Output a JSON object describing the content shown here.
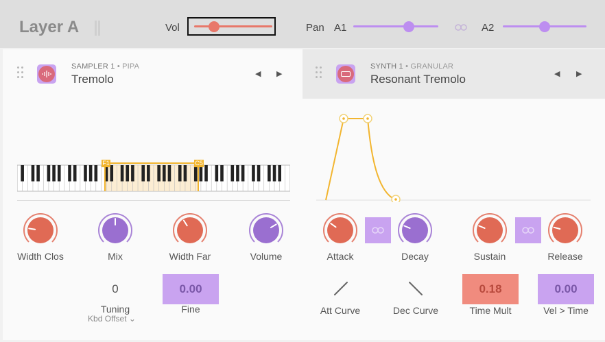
{
  "header": {
    "layer_title": "Layer A",
    "vol_label": "Vol",
    "vol_value": 0.25,
    "pan_label": "Pan",
    "a1_label": "A1",
    "a1_value": 0.65,
    "a2_label": "A2",
    "a2_value": 0.5
  },
  "left_panel": {
    "kicker": "SAMPLER 1",
    "kicker_sub": "• PIPA",
    "preset": "Tremolo",
    "keyboard_range": {
      "low_label": "F1",
      "high_label": "C5"
    },
    "knobs": [
      {
        "label": "Width Clos",
        "value": 0.2,
        "color": "#e06a55"
      },
      {
        "label": "Mix",
        "value": 0.5,
        "color": "#9a6fd0"
      },
      {
        "label": "Width Far",
        "value": 0.38,
        "color": "#e06a55"
      },
      {
        "label": "Volume",
        "value": 0.72,
        "color": "#9a6fd0"
      }
    ],
    "tuning_value": "0",
    "tuning_label": "Tuning",
    "kbd_offset_label": "Kbd Offset",
    "fine_value": "0.00",
    "fine_label": "Fine"
  },
  "right_panel": {
    "kicker": "SYNTH 1",
    "kicker_sub": "• GRANULAR",
    "preset": "Resonant Tremolo",
    "knobs": [
      {
        "label": "Attack",
        "value": 0.3,
        "color": "#e06a55"
      },
      {
        "label": "Decay",
        "value": 0.25,
        "color": "#9a6fd0"
      },
      {
        "label": "Sustain",
        "value": 0.25,
        "color": "#e06a55"
      },
      {
        "label": "Release",
        "value": 0.22,
        "color": "#e06a55"
      }
    ],
    "att_curve_label": "Att Curve",
    "dec_curve_label": "Dec Curve",
    "time_mult_value": "0.18",
    "time_mult_label": "Time Mult",
    "vel_time_value": "0.00",
    "vel_time_label": "Vel > Time"
  },
  "colors": {
    "accent_red": "#e8786a",
    "accent_purple": "#c9a3f0",
    "envelope": "#f2b52f"
  }
}
